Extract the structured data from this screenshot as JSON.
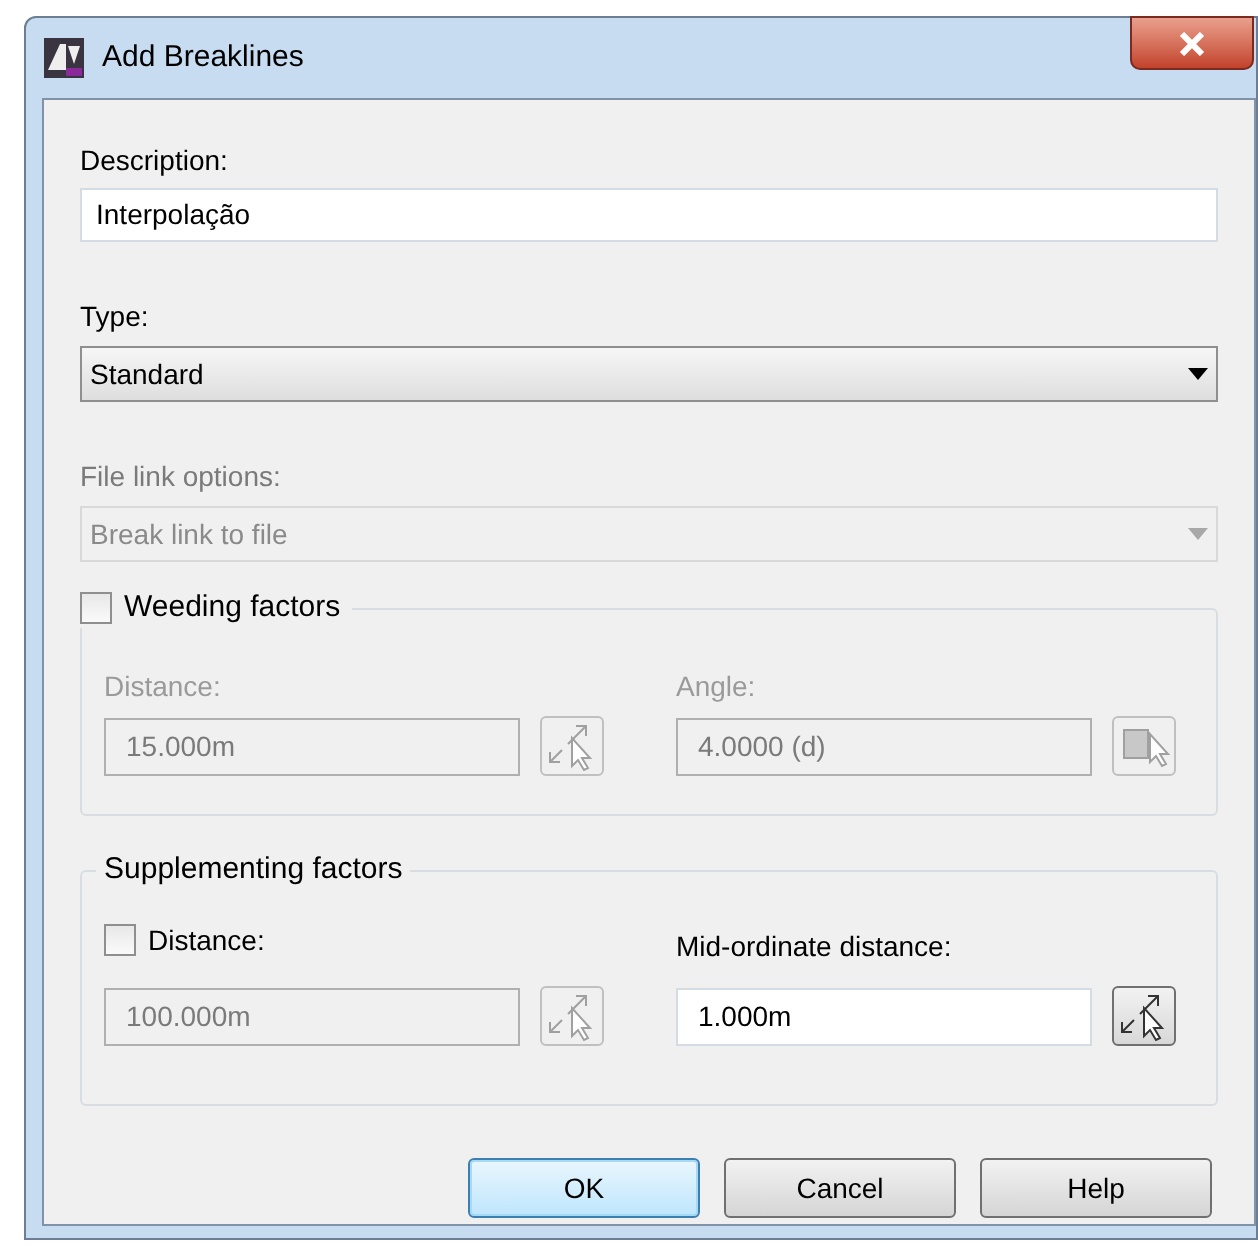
{
  "window": {
    "title": "Add Breaklines"
  },
  "description": {
    "label": "Description:",
    "value": "Interpolação"
  },
  "type": {
    "label": "Type:",
    "value": "Standard",
    "disabled": false
  },
  "file_link": {
    "label": "File link options:",
    "value": "Break link to file",
    "disabled": true
  },
  "weeding": {
    "label": "Weeding factors",
    "checked": false,
    "fields": [
      {
        "label": "Distance:",
        "value": "15.000m",
        "disabled": true,
        "kind": "distance"
      },
      {
        "label": "Angle:",
        "value": "4.0000 (d)",
        "disabled": true,
        "kind": "angle"
      }
    ]
  },
  "supplementing": {
    "label": "Supplementing factors",
    "fields": [
      {
        "label": "Distance:",
        "value": "100.000m",
        "disabled": true,
        "checked": false,
        "kind": "checkbox"
      },
      {
        "label": "Mid-ordinate distance:",
        "value": "1.000m",
        "disabled": false,
        "kind": "label"
      }
    ]
  },
  "buttons": [
    {
      "label": "OK",
      "default": true
    },
    {
      "label": "Cancel",
      "default": false
    },
    {
      "label": "Help",
      "default": false
    }
  ]
}
